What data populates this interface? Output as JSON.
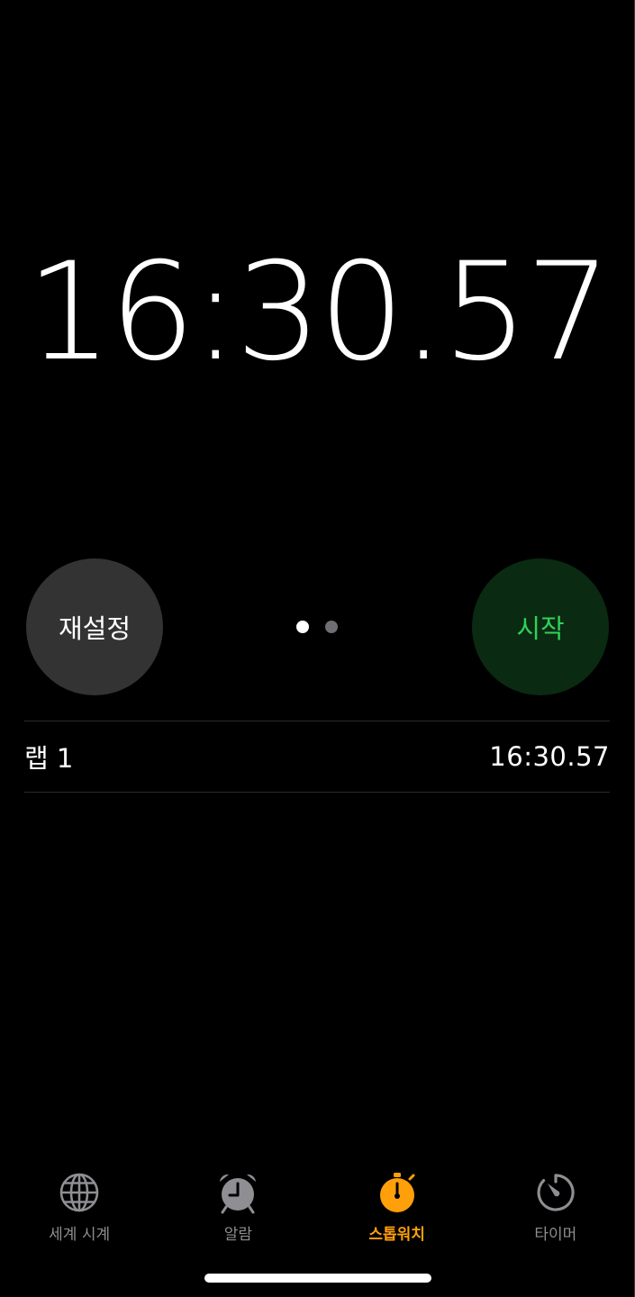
{
  "stopwatch": {
    "elapsed": "16:30.57"
  },
  "controls": {
    "reset_label": "재설정",
    "start_label": "시작",
    "page_dots": {
      "count": 2,
      "active_index": 0
    }
  },
  "laps": [
    {
      "label": "랩 1",
      "time": "16:30.57"
    }
  ],
  "tab_bar": {
    "active": "stopwatch",
    "tabs": [
      {
        "id": "world-clock",
        "label": "세계 시계",
        "icon": "globe-icon"
      },
      {
        "id": "alarm",
        "label": "알람",
        "icon": "alarm-clock-icon"
      },
      {
        "id": "stopwatch",
        "label": "스톱워치",
        "icon": "stopwatch-icon"
      },
      {
        "id": "timer",
        "label": "타이머",
        "icon": "timer-icon"
      }
    ]
  },
  "colors": {
    "background": "#000000",
    "reset_button": "#333333",
    "start_button": "#0a2a12",
    "start_text": "#30d158",
    "active_tab": "#ff9f0a",
    "inactive_tab": "#8e8e93"
  }
}
